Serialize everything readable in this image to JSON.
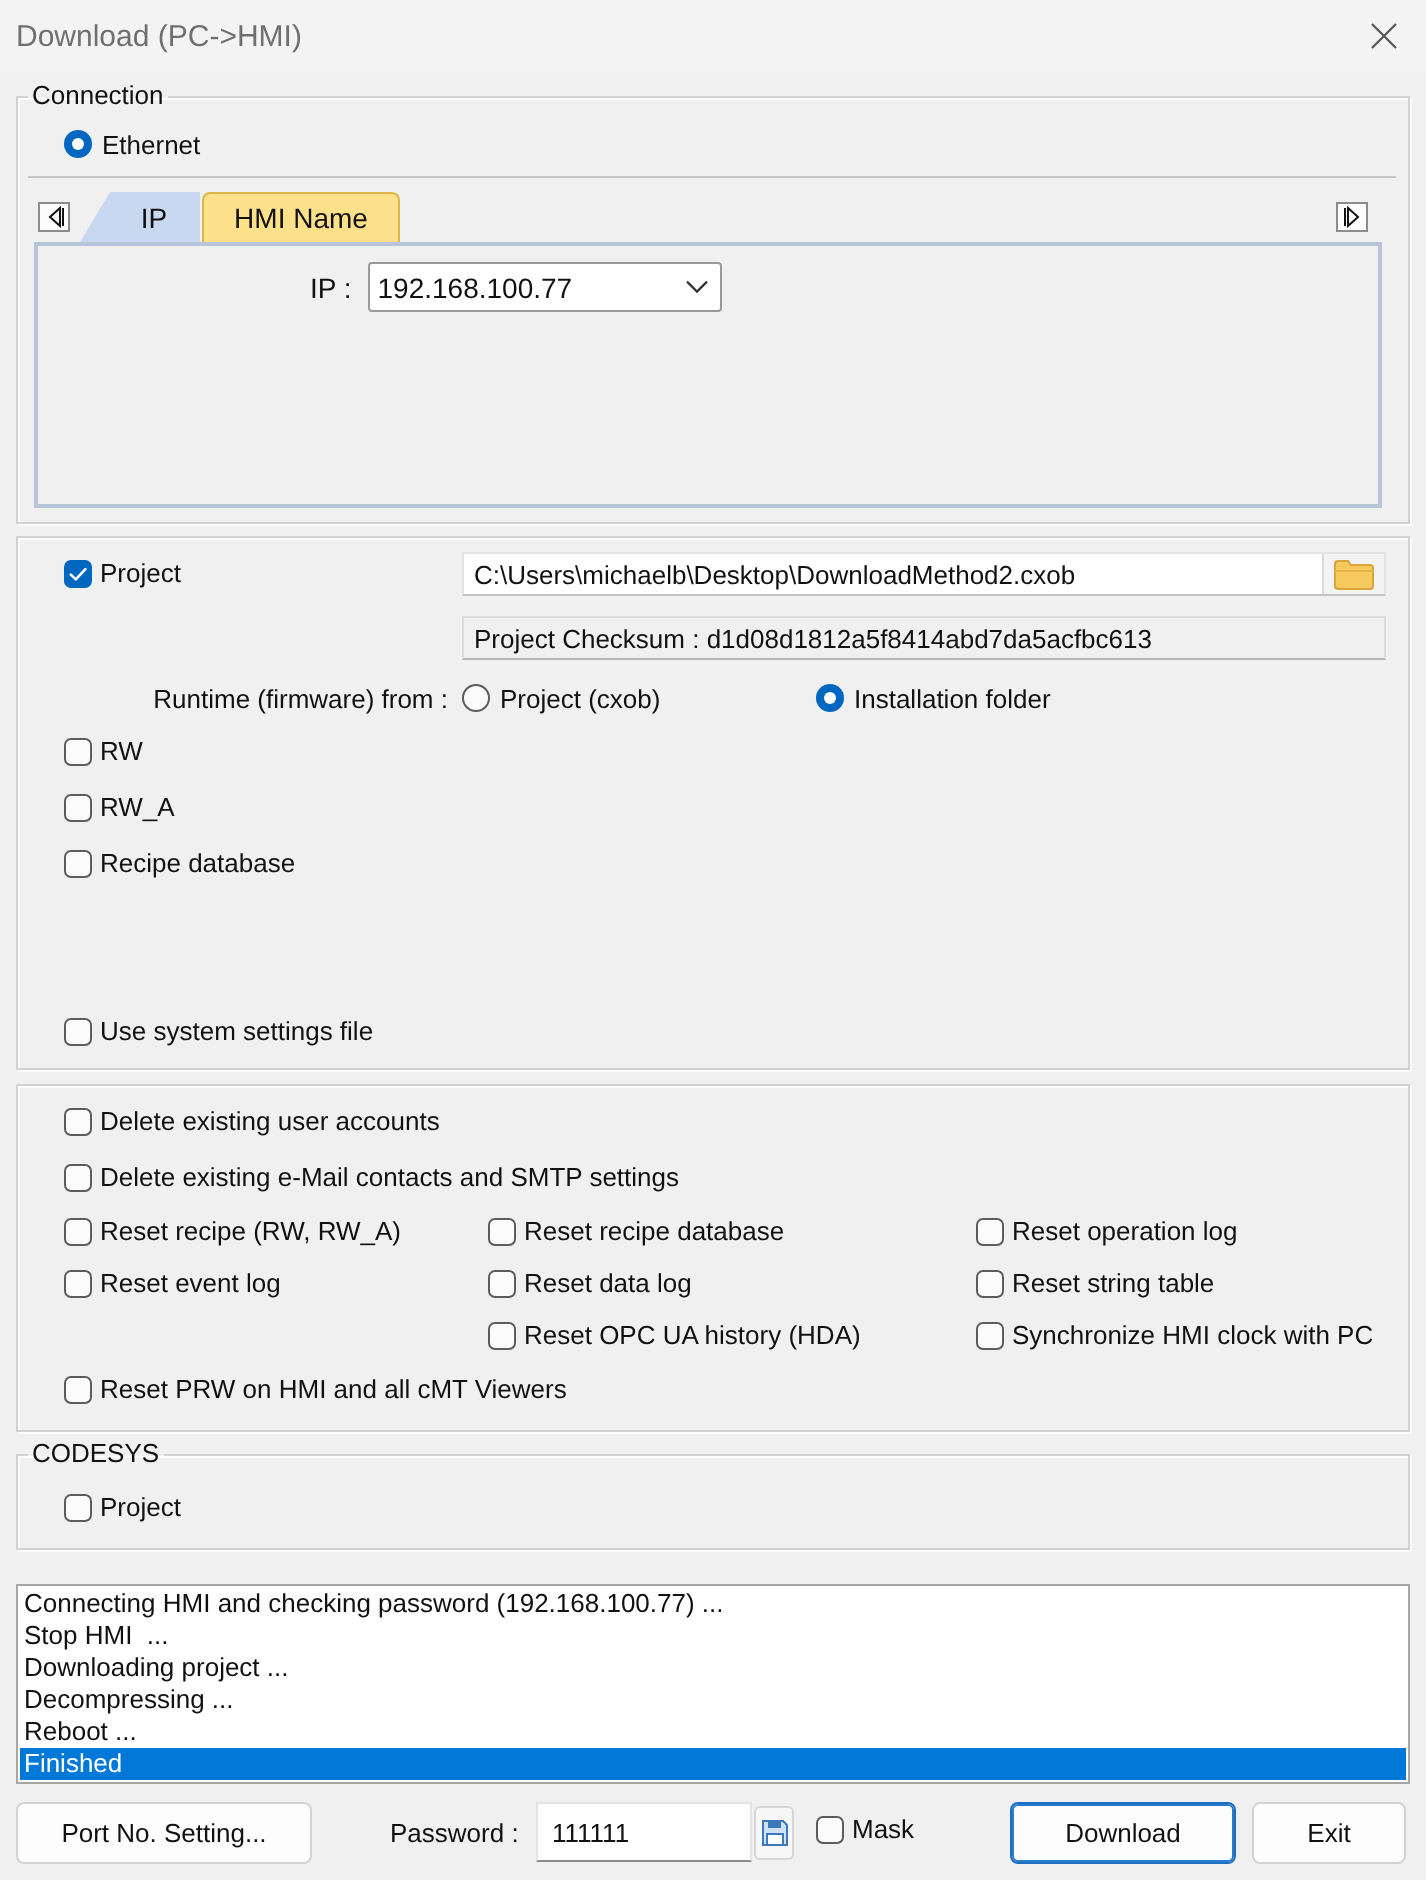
{
  "window": {
    "title": "Download (PC->HMI)"
  },
  "connection": {
    "legend": "Connection",
    "interfaces": [
      {
        "label": "Ethernet",
        "selected": true
      }
    ],
    "tabs": [
      {
        "label": "IP",
        "selected": true
      },
      {
        "label": "HMI Name",
        "selected": false
      }
    ],
    "ip": {
      "label": "IP :",
      "value": "192.168.100.77"
    }
  },
  "download": {
    "project": {
      "label": "Project",
      "checked": true
    },
    "path": "C:\\Users\\michaelb\\Desktop\\DownloadMethod2.cxob",
    "checksum": "Project Checksum : d1d08d1812a5f8414abd7da5acfbc613",
    "runtime": {
      "label": "Runtime (firmware) from :",
      "options": [
        {
          "label": "Project (cxob)",
          "selected": false
        },
        {
          "label": "Installation folder",
          "selected": true
        }
      ]
    },
    "items": [
      {
        "label": "RW",
        "checked": false
      },
      {
        "label": "RW_A",
        "checked": false
      },
      {
        "label": "Recipe database",
        "checked": false
      }
    ],
    "system_settings": {
      "label": "Use system settings file",
      "checked": false
    }
  },
  "reset": {
    "top": [
      {
        "label": "Delete existing user accounts",
        "checked": false
      },
      {
        "label": "Delete existing e-Mail contacts and SMTP settings",
        "checked": false
      }
    ],
    "columns": [
      [
        {
          "label": "Reset recipe (RW, RW_A)",
          "checked": false
        },
        {
          "label": "Reset event log",
          "checked": false
        }
      ],
      [
        {
          "label": "Reset recipe database",
          "checked": false
        },
        {
          "label": "Reset data log",
          "checked": false
        },
        {
          "label": "Reset OPC UA history (HDA)",
          "checked": false
        }
      ],
      [
        {
          "label": "Reset operation log",
          "checked": false
        },
        {
          "label": "Reset string table",
          "checked": false
        },
        {
          "label": "Synchronize HMI clock with PC",
          "checked": false
        }
      ]
    ],
    "bottom": [
      {
        "label": "Reset PRW on HMI and all cMT Viewers",
        "checked": false
      }
    ]
  },
  "codesys": {
    "legend": "CODESYS",
    "items": [
      {
        "label": "Project",
        "checked": false
      }
    ]
  },
  "log": {
    "lines": [
      {
        "text": "Connecting HMI and checking password (192.168.100.77) ...",
        "selected": false
      },
      {
        "text": "Stop HMI  ...",
        "selected": false
      },
      {
        "text": "Downloading project ...",
        "selected": false
      },
      {
        "text": "Decompressing ...",
        "selected": false
      },
      {
        "text": "Reboot ...",
        "selected": false
      },
      {
        "text": "Finished",
        "selected": true
      }
    ]
  },
  "footer": {
    "port_button": "Port No. Setting...",
    "password": {
      "label": "Password :",
      "value": "111111"
    },
    "mask": {
      "label": "Mask",
      "checked": false
    },
    "buttons": [
      {
        "label": "Download",
        "default": true
      },
      {
        "label": "Exit",
        "default": false
      }
    ]
  }
}
